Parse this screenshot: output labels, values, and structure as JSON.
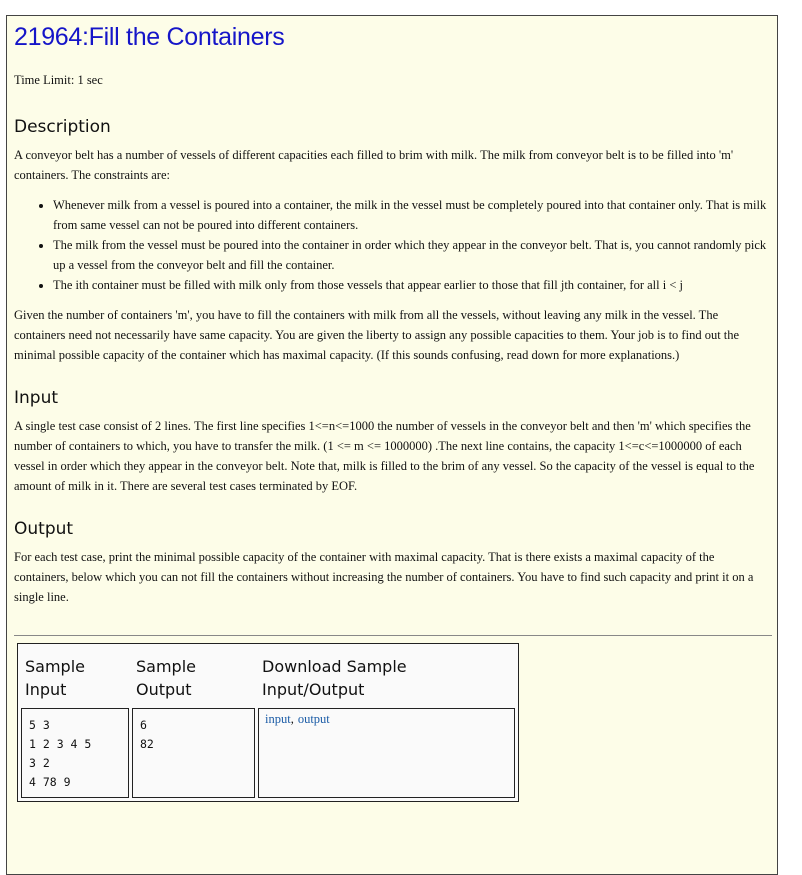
{
  "title": "21964:Fill the Containers",
  "time_limit": "Time Limit: 1 sec",
  "sections": {
    "description": {
      "heading": "Description",
      "intro": "A conveyor belt has a number of vessels of different capacities each filled to brim with milk. The milk from conveyor belt is to be filled into 'm' containers. The constraints are:",
      "constraints": [
        "Whenever milk from a vessel is poured into a container, the milk in the vessel must be completely poured into that container only. That is milk from same vessel can not be poured into different containers.",
        "The milk from the vessel must be poured into the container in order which they appear in the conveyor belt. That is, you cannot randomly pick up a vessel from the conveyor belt and fill the container.",
        "The ith container must be filled with milk only from those vessels that appear earlier to those that fill jth container, for all i < j"
      ],
      "given": "Given the number of containers 'm', you have to fill the containers with milk from all the vessels, without leaving any milk in the vessel. The containers need not necessarily have same capacity. You are given the liberty to assign any possible capacities to them. Your job is to find out the minimal possible capacity of the container which has maximal capacity. (If this sounds confusing, read down for more explanations.)"
    },
    "input": {
      "heading": "Input",
      "text": "A single test case consist of 2 lines. The first line specifies 1<=n<=1000 the number of vessels in the conveyor belt and then 'm' which specifies the number of containers to which, you have to transfer the milk. (1 <= m <= 1000000) .The next line contains, the capacity 1<=c<=1000000 of each vessel in order which they appear in the conveyor belt. Note that, milk is filled to the brim of any vessel. So the capacity of the vessel is equal to the amount of milk in it. There are several test cases terminated by EOF."
    },
    "output": {
      "heading": "Output",
      "text": "For each test case, print the minimal possible capacity of the container with maximal capacity. That is there exists a maximal capacity of the containers, below which you can not fill the containers without increasing the number of containers. You have to find such capacity and print it on a single line."
    }
  },
  "samples": {
    "headers": {
      "input": "Sample Input",
      "output": "Sample Output",
      "download": "Download Sample Input/Output"
    },
    "input_text": "5 3\n1 2 3 4 5\n3 2\n4 78 9",
    "output_text": "6\n82",
    "links": {
      "input": "input",
      "separator": ",",
      "output": "output"
    }
  },
  "colors": {
    "title": "#1515c8",
    "panel_bg": "#fdfde8",
    "link": "#1a5ba6"
  }
}
